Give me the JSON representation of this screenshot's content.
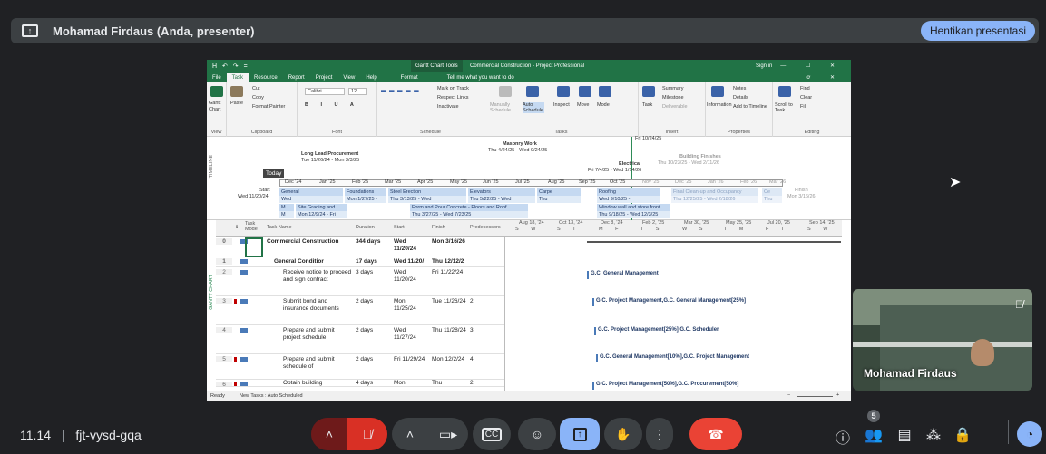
{
  "meet": {
    "presenter_label": "Mohamad Firdaus (Anda, presenter)",
    "stop_presenting_label": "Hentikan presentasi",
    "time": "11.14",
    "meeting_code": "fjt-vysd-gqa",
    "self_view_name": "Mohamad Firdaus",
    "people_count": "5",
    "icons": {
      "present": "present-screen-icon",
      "mic": "mic-off-icon",
      "cam": "camera-icon",
      "cc": "captions-icon",
      "emoji": "emoji-icon",
      "present_now": "present-now-icon",
      "hand": "raise-hand-icon",
      "more": "more-vert-icon",
      "leave": "call-end-icon",
      "info": "info-icon",
      "people": "people-icon",
      "chat": "chat-icon",
      "activities": "activities-icon",
      "host": "host-controls-icon",
      "ai": "ai-companion-icon"
    },
    "separator": "|"
  },
  "project": {
    "quick_access": "H ↶ ↷ =",
    "tool_context": "Gantt Chart Tools",
    "title": "Commercial Construction - Project Professional",
    "sign_in": "Sign in",
    "window_controls": "— ☐ ✕",
    "tabs": [
      "File",
      "Task",
      "Resource",
      "Report",
      "Project",
      "View",
      "Help",
      "Format"
    ],
    "tell_me": "Tell me what you want to do",
    "ribbon": {
      "view": "Gantt Chart",
      "view_group": "View",
      "paste": "Paste",
      "cut": "Cut",
      "copy": "Copy",
      "format_painter": "Format Painter",
      "clipboard": "Clipboard",
      "font_name": "Calibri",
      "font_size": "12",
      "font": "Font",
      "mark_on_track": "Mark on Track",
      "respect_links": "Respect Links",
      "inactivate": "Inactivate",
      "schedule": "Schedule",
      "manually": "Manually Schedule",
      "auto": "Auto Schedule",
      "inspect": "Inspect",
      "move": "Move",
      "mode": "Mode",
      "tasks": "Tasks",
      "task": "Task",
      "summary": "Summary",
      "milestone": "Milestone",
      "deliverable": "Deliverable",
      "insert": "Insert",
      "information": "Information",
      "notes": "Notes",
      "details": "Details",
      "add_to_timeline": "Add to Timeline",
      "properties": "Properties",
      "scroll_to_task": "Scroll to Task",
      "find": "Find",
      "clear": "Clear",
      "fill": "Fill",
      "editing": "Editing"
    },
    "timeline": {
      "label": "TIMELINE",
      "today": "Today",
      "start_label": "Start",
      "start_date": "Wed 11/20/24",
      "finish_label": "Finish",
      "finish_date": "Mon 3/16/26",
      "today_marker": "Fri 10/24/25",
      "ticks": [
        "Dec '24",
        "Jan '25",
        "Feb '25",
        "Mar '25",
        "Apr '25",
        "May '25",
        "Jun '25",
        "Jul '25",
        "Aug '25",
        "Sep '25",
        "Oct '25",
        "Nov '25",
        "Dec '25",
        "Jan '26",
        "Feb '26",
        "Mar '26"
      ],
      "callouts": [
        {
          "title": "Long Lead Procurement",
          "dates": "Tue 11/26/24 - Mon 3/3/25"
        },
        {
          "title": "Masonry Work",
          "dates": "Thu 4/24/25 - Wed 9/24/25"
        },
        {
          "title": "Electrical",
          "dates": "Fri 7/4/25 - Wed 1/14/26"
        },
        {
          "title": "Building Finishes",
          "dates": "Thu 10/23/25 - Wed 2/11/26"
        }
      ],
      "bars": [
        {
          "name": "General",
          "dates": "Wed"
        },
        {
          "name": "Foundations",
          "dates": "Mon 1/27/25 -"
        },
        {
          "name": "Steel Erection",
          "dates": "Thu 3/13/25 - Wed"
        },
        {
          "name": "Elevators",
          "dates": "Thu 5/22/25 - Wed"
        },
        {
          "name": "Carpe",
          "dates": "Thu"
        },
        {
          "name": "Roofing",
          "dates": "Wed 9/10/25 -"
        },
        {
          "name": "Final Clean-up and Occupancy",
          "dates": "Thu 12/25/25 - Wed 2/18/26"
        },
        {
          "name": "Ce",
          "dates": "Thu"
        },
        {
          "name": "M",
          "dates": "M"
        },
        {
          "name": "Site Grading and",
          "dates": "Mon 12/9/24 - Fri"
        },
        {
          "name": "Form and Pour Concrete - Floors and Roof",
          "dates": "Thu 3/27/25 - Wed 7/23/25"
        },
        {
          "name": "Window wall and store front",
          "dates": "Thu 9/18/25 - Wed 12/3/25"
        }
      ]
    },
    "grid": {
      "gantt_label": "GANTT CHART",
      "headers": {
        "info": "ℹ",
        "mode": "Task Mode",
        "name": "Task Name",
        "duration": "Duration",
        "start": "Start",
        "finish": "Finish",
        "predecessors": "Predecessors"
      },
      "chart_timescale": [
        {
          "week": "Aug 18, '24",
          "days": "S W"
        },
        {
          "week": "Oct 13, '24",
          "days": "S T"
        },
        {
          "week": "Dec 8, '24",
          "days": "M F"
        },
        {
          "week": "Feb 2, '25",
          "days": "T S"
        },
        {
          "week": "Mar 30, '25",
          "days": "W S"
        },
        {
          "week": "May 25, '25",
          "days": "T M"
        },
        {
          "week": "Jul 20, '25",
          "days": "F T"
        },
        {
          "week": "Sep 14, '25",
          "days": "S W"
        }
      ],
      "rows": [
        {
          "id": "0",
          "name": "Commercial Construction",
          "duration": "344 days",
          "start": "Wed 11/20/24",
          "finish": "Mon 3/16/26",
          "pred": "",
          "flag": false
        },
        {
          "id": "1",
          "name": "General Conditior",
          "duration": "17 days",
          "start": "Wed 11/20/",
          "finish": "Thu 12/12/2",
          "pred": "",
          "flag": false
        },
        {
          "id": "2",
          "name": "Receive notice to proceed and sign contract",
          "duration": "3 days",
          "start": "Wed 11/20/24",
          "finish": "Fri 11/22/24",
          "pred": "",
          "flag": false
        },
        {
          "id": "3",
          "name": "Submit bond and insurance documents",
          "duration": "2 days",
          "start": "Mon 11/25/24",
          "finish": "Tue 11/26/24",
          "pred": "2",
          "flag": true
        },
        {
          "id": "4",
          "name": "Prepare and submit project schedule",
          "duration": "2 days",
          "start": "Wed 11/27/24",
          "finish": "Thu 11/28/24",
          "pred": "3",
          "flag": false
        },
        {
          "id": "5",
          "name": "Prepare and submit schedule of",
          "duration": "2 days",
          "start": "Fri 11/29/24",
          "finish": "Mon 12/2/24",
          "pred": "4",
          "flag": true
        },
        {
          "id": "6",
          "name": "Obtain building",
          "duration": "4 days",
          "start": "Mon",
          "finish": "Thu",
          "pred": "2",
          "flag": true
        }
      ],
      "chart_labels": [
        "G.C. General Management",
        "G.C. Project Management,G.C. General Management[25%]",
        "G.C. Project Management[25%],G.C. Scheduler",
        "G.C. General Management[10%],G.C. Project Management",
        "G.C. Project Management[50%],G.C. Procurement[50%]"
      ]
    },
    "status": {
      "ready": "Ready",
      "new_tasks": "New Tasks : Auto Scheduled",
      "zoom_minus": "−",
      "zoom_plus": "+"
    }
  }
}
